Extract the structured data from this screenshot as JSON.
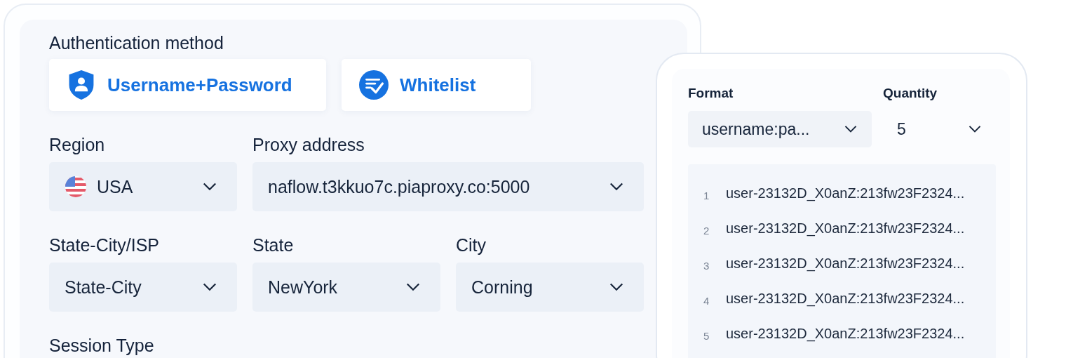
{
  "auth": {
    "label": "Authentication method",
    "options": [
      {
        "label": "Username+Password",
        "kind": "shield"
      },
      {
        "label": "Whitelist",
        "kind": "check"
      }
    ]
  },
  "rows": [
    {
      "fields": [
        {
          "label": "Region",
          "value": "USA",
          "kind": "flag"
        },
        {
          "label": "Proxy address",
          "value": "naflow.t3kkuo7c.piaproxy.co:5000",
          "kind": "plain"
        }
      ]
    },
    {
      "fields": [
        {
          "label": "State-City/ISP",
          "value": "State-City",
          "kind": "plain"
        },
        {
          "label": "State",
          "value": "NewYork",
          "kind": "plain"
        },
        {
          "label": "City",
          "value": "Corning",
          "kind": "plain"
        }
      ]
    }
  ],
  "session_type": {
    "label": "Session Type"
  },
  "format": {
    "label": "Format",
    "value": "username:pa..."
  },
  "quantity": {
    "label": "Quantity",
    "value": "5"
  },
  "lines": [
    {
      "number": "1",
      "text": "user-23132D_X0anZ:213fw23F2324..."
    },
    {
      "number": "2",
      "text": "user-23132D_X0anZ:213fw23F2324..."
    },
    {
      "number": "3",
      "text": "user-23132D_X0anZ:213fw23F2324..."
    },
    {
      "number": "4",
      "text": "user-23132D_X0anZ:213fw23F2324..."
    },
    {
      "number": "5",
      "text": "user-23132D_X0anZ:213fw23F2324..."
    }
  ]
}
